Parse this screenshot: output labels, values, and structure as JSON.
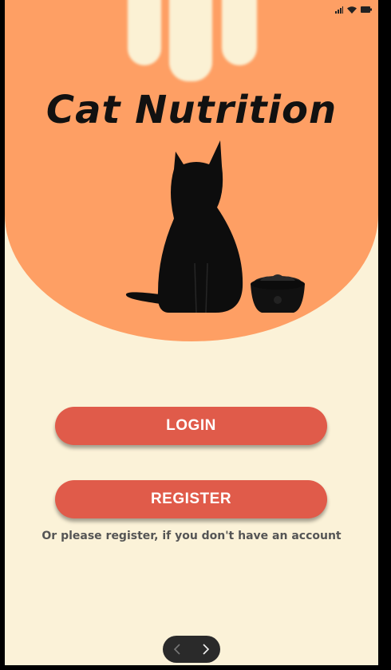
{
  "app": {
    "title": "Cat Nutrition"
  },
  "actions": {
    "login_label": "LOGIN",
    "register_label": "REGISTER",
    "register_hint": "Or please register, if you don't have an account"
  },
  "status_bar": {
    "icons": [
      "signal-icon",
      "wifi-icon",
      "battery-icon"
    ]
  },
  "navigation": {
    "icons": [
      "chevron-left-icon",
      "chevron-right-icon"
    ]
  },
  "colors": {
    "hero_background": "#fe9f64",
    "page_background": "#fbf2d8",
    "button": "#e05b4a",
    "title": "#111111"
  }
}
